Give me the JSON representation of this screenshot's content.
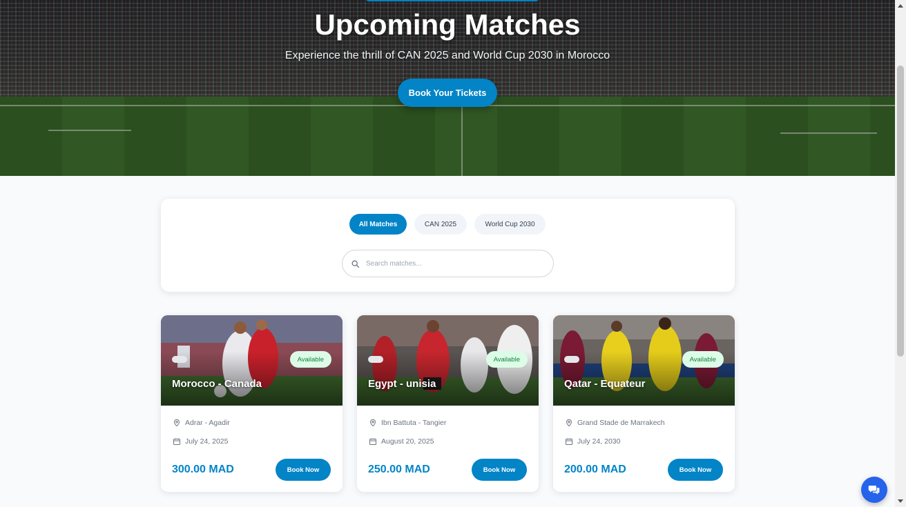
{
  "hero": {
    "title": "Upcoming Matches",
    "subtitle": "Experience the thrill of CAN 2025 and World Cup 2030 in Morocco",
    "cta_label": "Book Your Tickets"
  },
  "filters": {
    "tabs": [
      {
        "label": "All Matches",
        "active": true
      },
      {
        "label": "CAN 2025",
        "active": false
      },
      {
        "label": "World Cup 2030",
        "active": false
      }
    ],
    "search": {
      "placeholder": "Search matches...",
      "value": ""
    }
  },
  "matches": [
    {
      "title": "Morocco - Canada",
      "status": "Available",
      "venue": "Adrar - Agadir",
      "date": "July 24, 2025",
      "price": "300.00 MAD",
      "button": "Book Now"
    },
    {
      "title": "Egypt - unisia",
      "status": "Available",
      "venue": "Ibn Battuta - Tangier",
      "date": "August 20, 2025",
      "price": "250.00 MAD",
      "button": "Book Now"
    },
    {
      "title": "Qatar - Equateur",
      "status": "Available",
      "venue": "Grand Stade de Marrakech",
      "date": "July 24, 2030",
      "price": "200.00 MAD",
      "button": "Book Now"
    }
  ],
  "colors": {
    "accent": "#0284c7",
    "available_bg": "#dcfce7",
    "available_text": "#15803d",
    "chat": "#2563eb"
  },
  "icons": {
    "search": "search-icon",
    "venue": "map-pin-icon",
    "date": "calendar-icon",
    "chat": "chat-bubbles-icon"
  }
}
